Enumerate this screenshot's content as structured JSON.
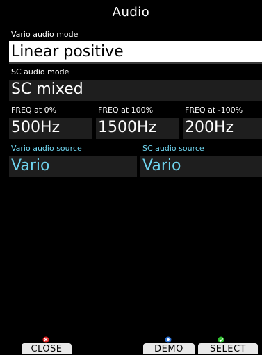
{
  "window": {
    "title": "Audio"
  },
  "fields": {
    "vario_audio_mode": {
      "label": "Vario audio mode",
      "value": "Linear positive"
    },
    "sc_audio_mode": {
      "label": "SC audio mode",
      "value": "SC mixed"
    },
    "freq_0": {
      "label": "FREQ at 0%",
      "value": "500Hz"
    },
    "freq_100": {
      "label": "FREQ at 100%",
      "value": "1500Hz"
    },
    "freq_neg100": {
      "label": "FREQ at -100%",
      "value": "200Hz"
    },
    "vario_audio_source": {
      "label": "Vario audio source",
      "value": "Vario"
    },
    "sc_audio_source": {
      "label": "SC audio source",
      "value": "Vario"
    }
  },
  "buttons": {
    "close": {
      "label": "CLOSE",
      "icon": "close-icon"
    },
    "demo": {
      "label": "DEMO",
      "icon": "demo-icon"
    },
    "select": {
      "label": "SELECT",
      "icon": "check-icon"
    }
  },
  "colors": {
    "background": "#000000",
    "field_background": "#1e1e1e",
    "accent_cyan": "#6fd4ee",
    "focused_background": "#ffffff",
    "close_icon": "#e02020",
    "demo_icon": "#2a6fd0",
    "select_icon": "#2fbf2f"
  }
}
